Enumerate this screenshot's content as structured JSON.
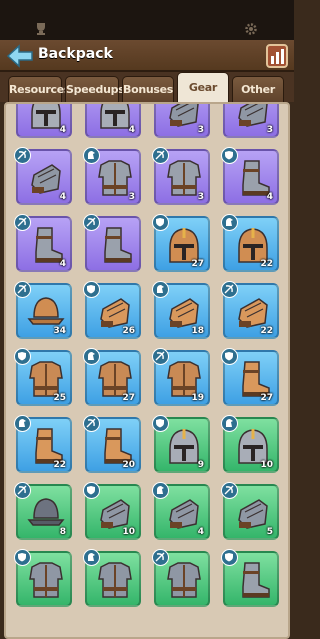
{
  "header": {
    "title": "Backpack"
  },
  "tabs": [
    {
      "label": "Resources",
      "active": false
    },
    {
      "label": "Speedups",
      "active": false
    },
    {
      "label": "Bonuses",
      "active": false
    },
    {
      "label": "Gear",
      "active": true
    },
    {
      "label": "Other",
      "active": false
    }
  ],
  "items": [
    {
      "rarity": "purple",
      "type": "helmet",
      "badge": "sword",
      "count": "4"
    },
    {
      "rarity": "purple",
      "type": "helmet",
      "badge": "sword",
      "count": "4"
    },
    {
      "rarity": "purple",
      "type": "gauntlet",
      "badge": "sword",
      "count": "3"
    },
    {
      "rarity": "purple",
      "type": "gauntlet",
      "badge": "sword",
      "count": "3"
    },
    {
      "rarity": "purple",
      "type": "gauntlet",
      "badge": "bow",
      "count": "4"
    },
    {
      "rarity": "purple",
      "type": "chest",
      "badge": "horse",
      "count": "3"
    },
    {
      "rarity": "purple",
      "type": "chest",
      "badge": "bow",
      "count": "3"
    },
    {
      "rarity": "purple",
      "type": "boot",
      "badge": "shield",
      "count": "4"
    },
    {
      "rarity": "purple",
      "type": "boot",
      "badge": "bow",
      "count": "4"
    },
    {
      "rarity": "purple",
      "type": "boot",
      "badge": "bow",
      "count": ""
    },
    {
      "rarity": "blue",
      "type": "helmet",
      "badge": "shield",
      "count": "27"
    },
    {
      "rarity": "blue",
      "type": "helmet",
      "badge": "horse",
      "count": "22"
    },
    {
      "rarity": "blue",
      "type": "hat",
      "badge": "bow",
      "count": "34"
    },
    {
      "rarity": "blue",
      "type": "gauntlet",
      "badge": "shield",
      "count": "26"
    },
    {
      "rarity": "blue",
      "type": "gauntlet",
      "badge": "horse",
      "count": "18"
    },
    {
      "rarity": "blue",
      "type": "gauntlet",
      "badge": "bow",
      "count": "22"
    },
    {
      "rarity": "blue",
      "type": "chest",
      "badge": "shield",
      "count": "25"
    },
    {
      "rarity": "blue",
      "type": "chest",
      "badge": "horse",
      "count": "27"
    },
    {
      "rarity": "blue",
      "type": "chest",
      "badge": "bow",
      "count": "19"
    },
    {
      "rarity": "blue",
      "type": "boot",
      "badge": "shield",
      "count": "27"
    },
    {
      "rarity": "blue",
      "type": "boot",
      "badge": "horse",
      "count": "22"
    },
    {
      "rarity": "blue",
      "type": "boot",
      "badge": "bow",
      "count": "20"
    },
    {
      "rarity": "green",
      "type": "helmet",
      "badge": "shield",
      "count": "9"
    },
    {
      "rarity": "green",
      "type": "helmet",
      "badge": "horse",
      "count": "10"
    },
    {
      "rarity": "green",
      "type": "hat",
      "badge": "bow",
      "count": "8"
    },
    {
      "rarity": "green",
      "type": "gauntlet",
      "badge": "shield",
      "count": "10"
    },
    {
      "rarity": "green",
      "type": "gauntlet",
      "badge": "horse",
      "count": "4"
    },
    {
      "rarity": "green",
      "type": "gauntlet",
      "badge": "bow",
      "count": "5"
    },
    {
      "rarity": "green",
      "type": "chest",
      "badge": "shield",
      "count": ""
    },
    {
      "rarity": "green",
      "type": "chest",
      "badge": "horse",
      "count": ""
    },
    {
      "rarity": "green",
      "type": "chest",
      "badge": "bow",
      "count": ""
    },
    {
      "rarity": "green",
      "type": "boot",
      "badge": "shield",
      "count": ""
    }
  ],
  "colors": {
    "badge": "#2e6f8f",
    "panel": "#d8c9b4",
    "active_tab": "#efe6d6"
  }
}
